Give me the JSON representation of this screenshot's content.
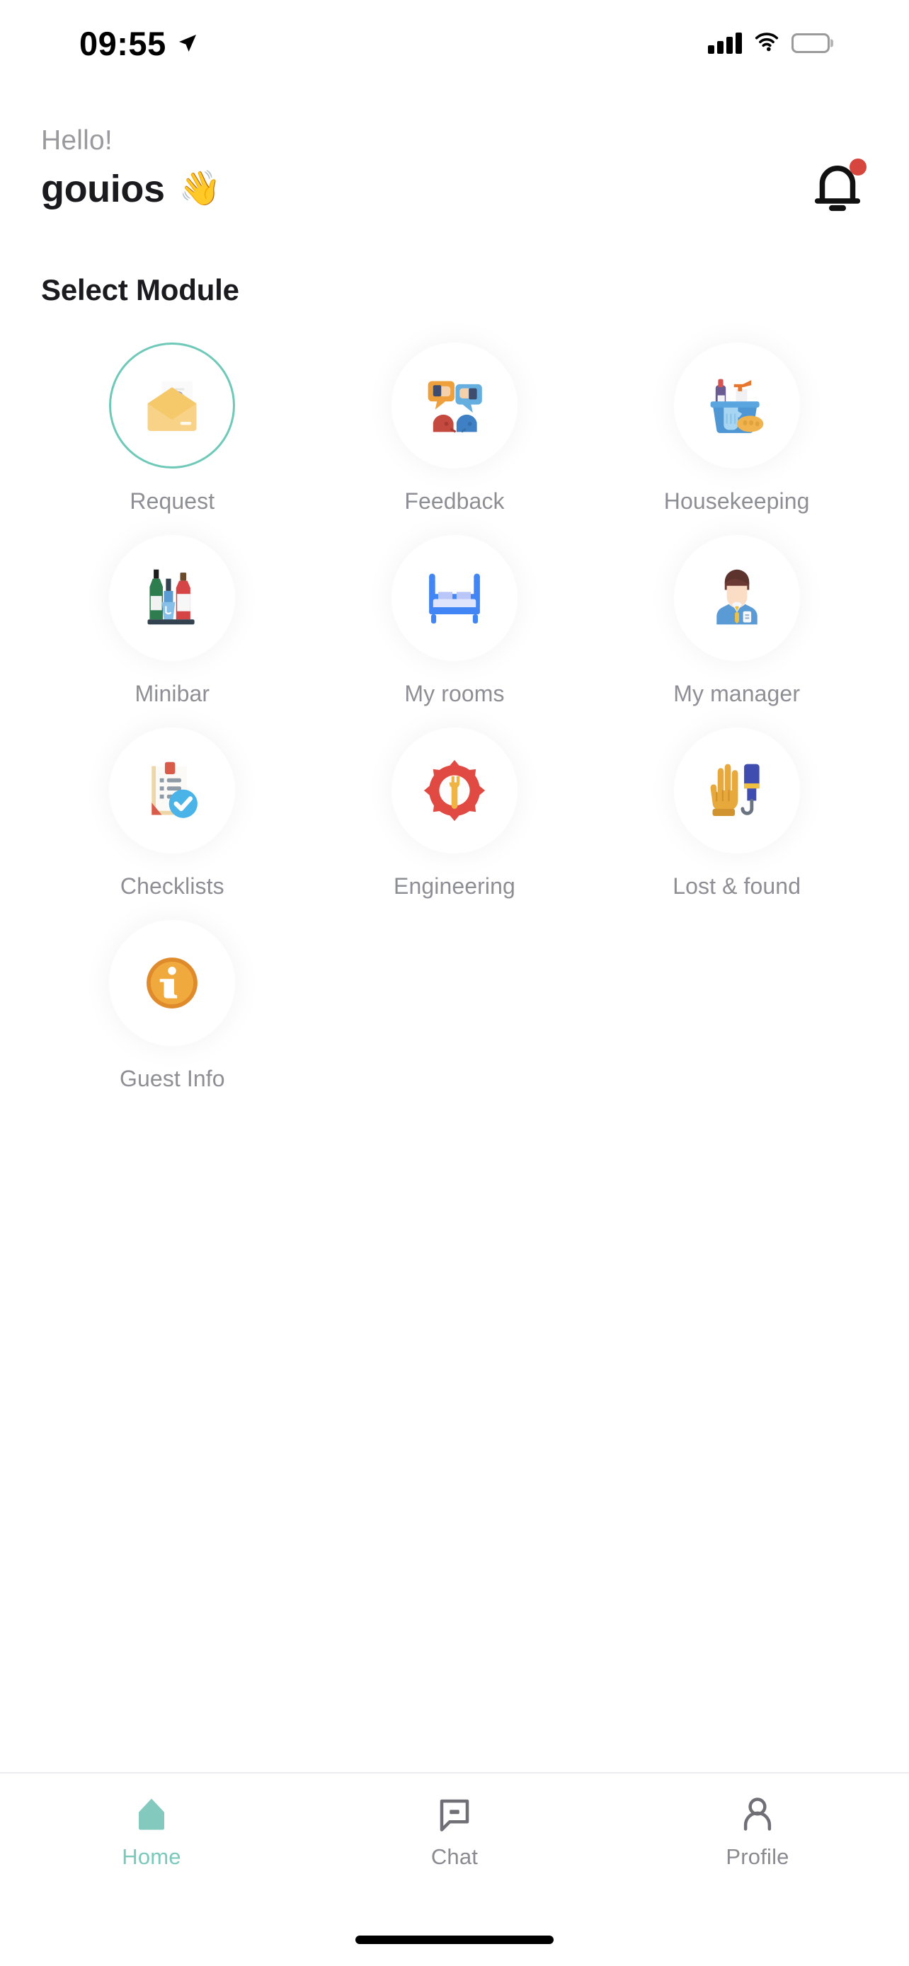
{
  "status_bar": {
    "time": "09:55",
    "location_icon": "location-arrow-icon",
    "signal_icon": "cellular-signal-icon",
    "wifi_icon": "wifi-icon",
    "battery_icon": "battery-icon"
  },
  "header": {
    "greeting": "Hello!",
    "username": "gouios",
    "wave_emoji": "👋",
    "notification_icon": "bell-icon",
    "notification_badge_color": "#d6453e"
  },
  "section": {
    "title": "Select Module"
  },
  "theme": {
    "accent": "#6ec9b8",
    "label_gray": "#8e8e95",
    "title_dark": "#1b1b1f"
  },
  "modules": [
    {
      "id": "request",
      "label": "Request",
      "icon": "envelope-question-icon",
      "selected": true
    },
    {
      "id": "feedback",
      "label": "Feedback",
      "icon": "feedback-people-icon",
      "selected": false
    },
    {
      "id": "housekeeping",
      "label": "Housekeeping",
      "icon": "cleaning-bucket-icon",
      "selected": false
    },
    {
      "id": "minibar",
      "label": "Minibar",
      "icon": "bottles-icon",
      "selected": false
    },
    {
      "id": "my-rooms",
      "label": "My rooms",
      "icon": "bed-icon",
      "selected": false
    },
    {
      "id": "my-manager",
      "label": "My manager",
      "icon": "manager-person-icon",
      "selected": false
    },
    {
      "id": "checklists",
      "label": "Checklists",
      "icon": "clipboard-check-icon",
      "selected": false
    },
    {
      "id": "engineering",
      "label": "Engineering",
      "icon": "gear-wrench-icon",
      "selected": false
    },
    {
      "id": "lost-found",
      "label": "Lost & found",
      "icon": "glove-umbrella-icon",
      "selected": false
    },
    {
      "id": "guest-info",
      "label": "Guest Info",
      "icon": "info-circle-icon",
      "selected": false
    }
  ],
  "tab_bar": {
    "tabs": [
      {
        "id": "home",
        "label": "Home",
        "icon": "home-icon",
        "active": true
      },
      {
        "id": "chat",
        "label": "Chat",
        "icon": "chat-icon",
        "active": false
      },
      {
        "id": "profile",
        "label": "Profile",
        "icon": "profile-icon",
        "active": false
      }
    ]
  }
}
